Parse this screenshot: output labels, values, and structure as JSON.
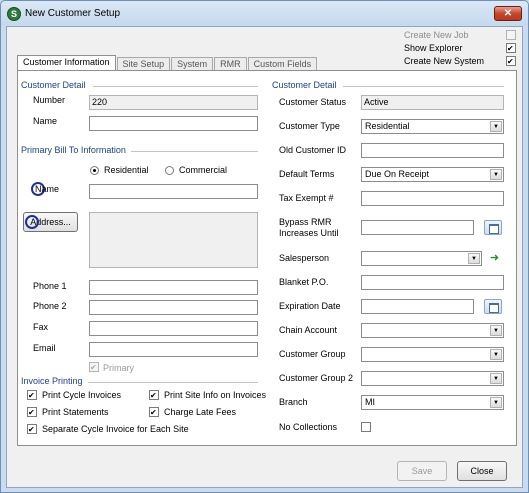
{
  "window": {
    "title": "New Customer Setup",
    "close": "✕",
    "app_glyph": "S"
  },
  "top_options": [
    {
      "label": "Create New Job",
      "checked": false,
      "disabled": true
    },
    {
      "label": "Show Explorer",
      "checked": true,
      "disabled": false
    },
    {
      "label": "Create New System",
      "checked": true,
      "disabled": false
    }
  ],
  "tabs": [
    "Customer Information",
    "Site Setup",
    "System",
    "RMR",
    "Custom Fields"
  ],
  "customer_detail_left": {
    "heading": "Customer Detail",
    "number_label": "Number",
    "number_value": "220",
    "name_label": "Name",
    "name_value": ""
  },
  "bill_to": {
    "heading": "Primary Bill To Information",
    "residential": "Residential",
    "commercial": "Commercial",
    "name_label": "Name",
    "name_value": "",
    "address_button": "Address...",
    "address_value": "",
    "phone1_label": "Phone 1",
    "phone2_label": "Phone 2",
    "fax_label": "Fax",
    "email_label": "Email",
    "primary_label": "Primary"
  },
  "invoice_printing": {
    "heading": "Invoice Printing",
    "print_cycle": "Print Cycle Invoices",
    "print_site": "Print Site Info on Invoices",
    "print_statements": "Print Statements",
    "charge_late": "Charge Late Fees",
    "separate_cycle": "Separate Cycle Invoice for Each Site"
  },
  "customer_detail_right": {
    "heading": "Customer Detail",
    "status_label": "Customer Status",
    "status_value": "Active",
    "type_label": "Customer Type",
    "type_value": "Residential",
    "old_id_label": "Old Customer ID",
    "terms_label": "Default Terms",
    "terms_value": "Due On Receipt",
    "tax_label": "Tax Exempt #",
    "bypass_label_1": "Bypass RMR",
    "bypass_label_2": "Increases Until",
    "salesperson_label": "Salesperson",
    "blanket_label": "Blanket P.O.",
    "expiration_label": "Expiration Date",
    "chain_label": "Chain Account",
    "group_label": "Customer Group",
    "group2_label": "Customer Group 2",
    "branch_label": "Branch",
    "branch_value": "MI",
    "no_collections_label": "No Collections"
  },
  "footer": {
    "save": "Save",
    "close": "Close"
  },
  "dropdown_arrow": "▼"
}
